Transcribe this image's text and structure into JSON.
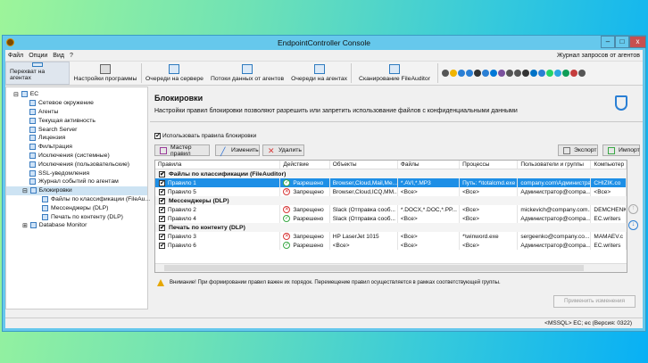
{
  "window": {
    "title": "EndpointController Console",
    "minimize": "–",
    "maximize": "□",
    "close": "x"
  },
  "menu": {
    "items": [
      "Файл",
      "Опции",
      "Вид",
      "?"
    ],
    "right": "Журнал запросов от агентов"
  },
  "toolbar": {
    "buttons": [
      "Перехват на агентах",
      "Настройки программы",
      "Очереди на сервере",
      "Потоки данных от агентов",
      "Очереди на агентах",
      "Сканирование FileAuditor"
    ],
    "quick_icons": [
      "usb-icon",
      "folder-icon",
      "ftp-icon",
      "globe-icon",
      "keyboard-icon",
      "monitor-icon",
      "skype-icon",
      "viber-icon",
      "printer-icon",
      "microphone-icon",
      "clock-icon",
      "outlook-icon",
      "icq-icon",
      "whatsapp-icon",
      "telegram-icon",
      "hangouts-icon",
      "slack-icon",
      "scan-icon"
    ],
    "quick_colors": [
      "#555",
      "#f0b400",
      "#2a7fd4",
      "#2a7fd4",
      "#333",
      "#2a7fd4",
      "#0078d7",
      "#7b519d",
      "#555",
      "#555",
      "#333",
      "#0072c6",
      "#2a7fd4",
      "#25d366",
      "#2ca5e0",
      "#0f9d58",
      "#c43c3c",
      "#555"
    ]
  },
  "tree": {
    "items": [
      {
        "label": "EC",
        "level": 0,
        "expander": "⊟"
      },
      {
        "label": "Сетевое окружение",
        "level": 1
      },
      {
        "label": "Агенты",
        "level": 1
      },
      {
        "label": "Текущая активность",
        "level": 1
      },
      {
        "label": "Search Server",
        "level": 1
      },
      {
        "label": "Лицензия",
        "level": 1
      },
      {
        "label": "Фильтрация",
        "level": 1
      },
      {
        "label": "Исключения (системные)",
        "level": 1
      },
      {
        "label": "Исключения (пользовательские)",
        "level": 1
      },
      {
        "label": "SSL-уведомления",
        "level": 1
      },
      {
        "label": "Журнал событий по агентам",
        "level": 1
      },
      {
        "label": "Блокировки",
        "level": 1,
        "expander": "⊟",
        "selected": true
      },
      {
        "label": "Файлы по классификации (FileAu...",
        "level": 2
      },
      {
        "label": "Мессенджеры (DLP)",
        "level": 2
      },
      {
        "label": "Печать по контенту (DLP)",
        "level": 2
      },
      {
        "label": "Database Monitor",
        "level": 1,
        "expander": "⊞"
      }
    ]
  },
  "main": {
    "title": "Блокировки",
    "description": "Настройки правил блокировки позволяют разрешить или запретить использование файлов с конфиденциальными данными",
    "use_rules": "Использовать правила блокировки",
    "use_rules_checked": true,
    "buttons": {
      "wizard": "Мастер правил",
      "edit": "Изменить",
      "delete": "Удалить",
      "export": "Экспорт",
      "import": "Импорт"
    },
    "columns": [
      "Правила",
      "Действие",
      "Объекты",
      "Файлы",
      "Процессы",
      "Пользователи и группы",
      "Компьютер"
    ],
    "groups": [
      {
        "name": "Файлы по классификации (FileAuditor)",
        "rows": [
          {
            "rule": "Правило 1",
            "action": "Разрешено",
            "status": "allow",
            "objects": "Browser,Cloud,Mail,Me...",
            "files": "*.AVI,*.MP3",
            "processes": "Путь: *\\totalcmd.exe",
            "users": "company.com\\Администрат...",
            "computer": "CHIZIK.co",
            "selected": true
          },
          {
            "rule": "Правило 5",
            "action": "Запрещено",
            "status": "deny",
            "objects": "Browser,Cloud,ICQ,MM...",
            "files": "<Все>",
            "processes": "<Все>",
            "users": "Администратор@compa...",
            "computer": "<Все>"
          }
        ]
      },
      {
        "name": "Мессенджеры (DLP)",
        "rows": [
          {
            "rule": "Правило 2",
            "action": "Запрещено",
            "status": "deny",
            "objects": "Slack (Отправка сооб...",
            "files": "*.DOCX,*.DOC,*.PP...",
            "processes": "<Все>",
            "users": "mickevich@company.com...",
            "computer": "DEMCHENK"
          },
          {
            "rule": "Правило 4",
            "action": "Разрешено",
            "status": "allow",
            "objects": "Slack (Отправка сооб...",
            "files": "<Все>",
            "processes": "<Все>",
            "users": "Администратор@compa...",
            "computer": "EC.writers"
          }
        ]
      },
      {
        "name": "Печать по контенту (DLP)",
        "rows": [
          {
            "rule": "Правило 3",
            "action": "Запрещено",
            "status": "deny",
            "objects": "HP LaserJet 1015",
            "files": "<Все>",
            "processes": "*\\winword.exe",
            "users": "sergeenko@company.co...",
            "computer": "MAMAEV.c"
          },
          {
            "rule": "Правило 6",
            "action": "Разрешено",
            "status": "allow",
            "objects": "<Все>",
            "files": "<Все>",
            "processes": "<Все>",
            "users": "Администратор@compa...",
            "computer": "EC.writers"
          }
        ]
      }
    ],
    "warning": "Внимание! При формировании правил важен их порядок. Перемещение правил осуществляется в рамках соответствующей группы.",
    "apply": "Применить изменения",
    "move_up": "↑",
    "move_down": "↓"
  },
  "status": "<MSSQL> EC; ec (Версия: 0322)"
}
